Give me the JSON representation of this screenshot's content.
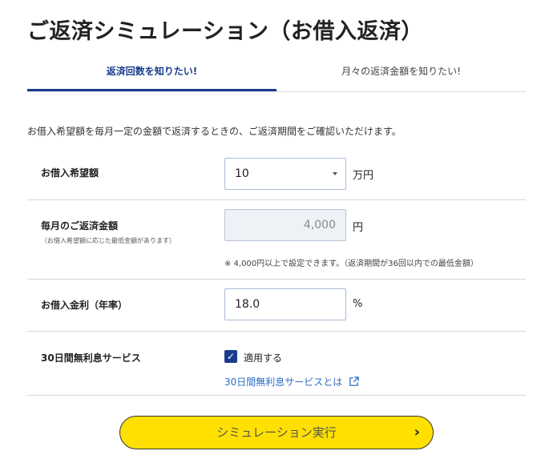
{
  "title": "ご返済シミュレーション（お借入返済）",
  "tabs": [
    {
      "label": "返済回数を知りたい!"
    },
    {
      "label": "月々の返済金額を知りたい!"
    }
  ],
  "intro": "お借入希望額を毎月一定の金額で返済するときの、ご返済期間をご確認いただけます。",
  "loan_amount": {
    "label": "お借入希望額",
    "value": "10",
    "unit": "万円"
  },
  "monthly_payment": {
    "label": "毎月のご返済金額",
    "sublabel": "（お借入希望額に応じた最低金額があります）",
    "value": "4,000",
    "unit": "円",
    "note": "※ 4,000円以上で設定できます。（返済期間が36回以内での最低金額）"
  },
  "interest_rate": {
    "label": "お借入金利（年率）",
    "value": "18.0",
    "unit": "%"
  },
  "interest_free": {
    "label": "30日間無利息サービス",
    "checkbox_label": "適用する",
    "checked": true,
    "link": "30日間無利息サービスとは"
  },
  "cta": {
    "label": "シミュレーション実行"
  },
  "colors": {
    "accent": "#1a3c8c",
    "cta": "#ffe000",
    "link": "#2b6cc4"
  }
}
